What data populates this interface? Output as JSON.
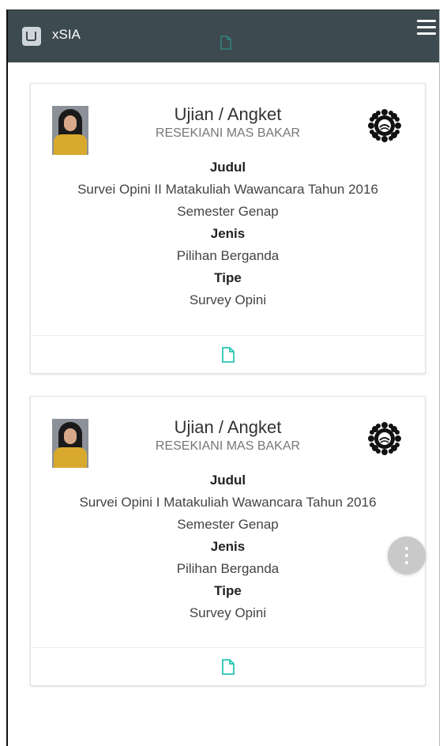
{
  "app": {
    "title": "xSIA",
    "accent_color": "#3d4a50",
    "menu_icon": "hamburger-icon",
    "logo_icon": "xsia-logo-icon"
  },
  "cards": [
    {
      "title": "Ujian / Angket",
      "author": "RESEKIANI MAS BAKAR",
      "judul_label": "Judul",
      "judul_value": "Survei Opini II Matakuliah Wawancara Tahun 2016",
      "semester": "Semester Genap",
      "jenis_label": "Jenis",
      "jenis_value": "Pilihan Berganda",
      "tipe_label": "Tipe",
      "tipe_value": "Survey Opini",
      "footer_icon": "file-icon",
      "footer_icon_color": "#26c6b6"
    },
    {
      "title": "Ujian / Angket",
      "author": "RESEKIANI MAS BAKAR",
      "judul_label": "Judul",
      "judul_value": "Survei Opini I Matakuliah Wawancara Tahun 2016",
      "semester": "Semester Genap",
      "jenis_label": "Jenis",
      "jenis_value": "Pilihan Berganda",
      "tipe_label": "Tipe",
      "tipe_value": "Survey Opini",
      "footer_icon": "file-icon",
      "footer_icon_color": "#26c6b6"
    }
  ],
  "fab": {
    "icon": "more-vertical-icon"
  }
}
